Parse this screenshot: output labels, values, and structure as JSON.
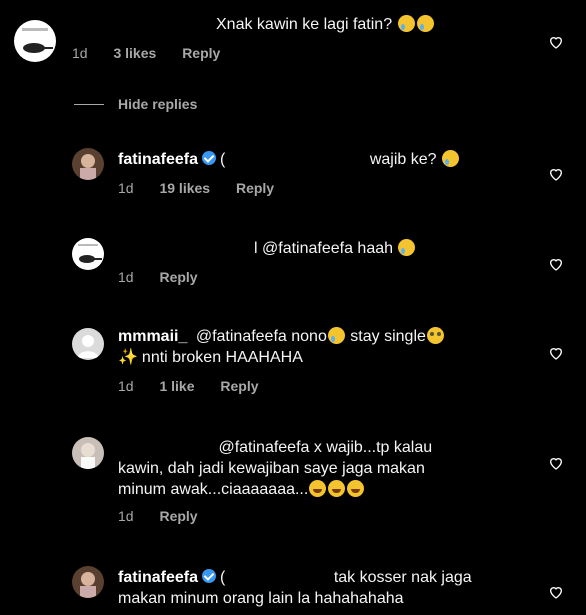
{
  "comments": [
    {
      "username": "",
      "text": "Xnak kawin ke lagi fatin?",
      "time": "1d",
      "likes": "3 likes",
      "reply": "Reply"
    },
    {
      "username": "fatinafeefa",
      "text": "wajib ke?",
      "time": "1d",
      "likes": "19 likes",
      "reply": "Reply"
    },
    {
      "username": "",
      "text": "l @fatinafeefa haah",
      "time": "1d",
      "likes": "",
      "reply": "Reply"
    },
    {
      "username": "mmmaii_",
      "text1": "@fatinafeefa nono",
      "text2": "stay single",
      "text3": "nnti broken HAAHAHA",
      "time": "1d",
      "likes": "1 like",
      "reply": "Reply"
    },
    {
      "username": "",
      "text1": "@fatinafeefa x wajib...tp kalau",
      "text2": "kawin, dah jadi kewajiban saye jaga makan",
      "text3": "minum awak...ciaaaaaaa...",
      "time": "1d",
      "likes": "",
      "reply": "Reply"
    },
    {
      "username": "fatinafeefa",
      "text1": "tak kosser nak jaga",
      "text2": "makan minum orang lain la hahahahaha"
    }
  ],
  "hide_replies": "Hide replies",
  "colors": {
    "background": "#000000",
    "meta": "#a8a8a8",
    "verified": "#3897f0"
  }
}
